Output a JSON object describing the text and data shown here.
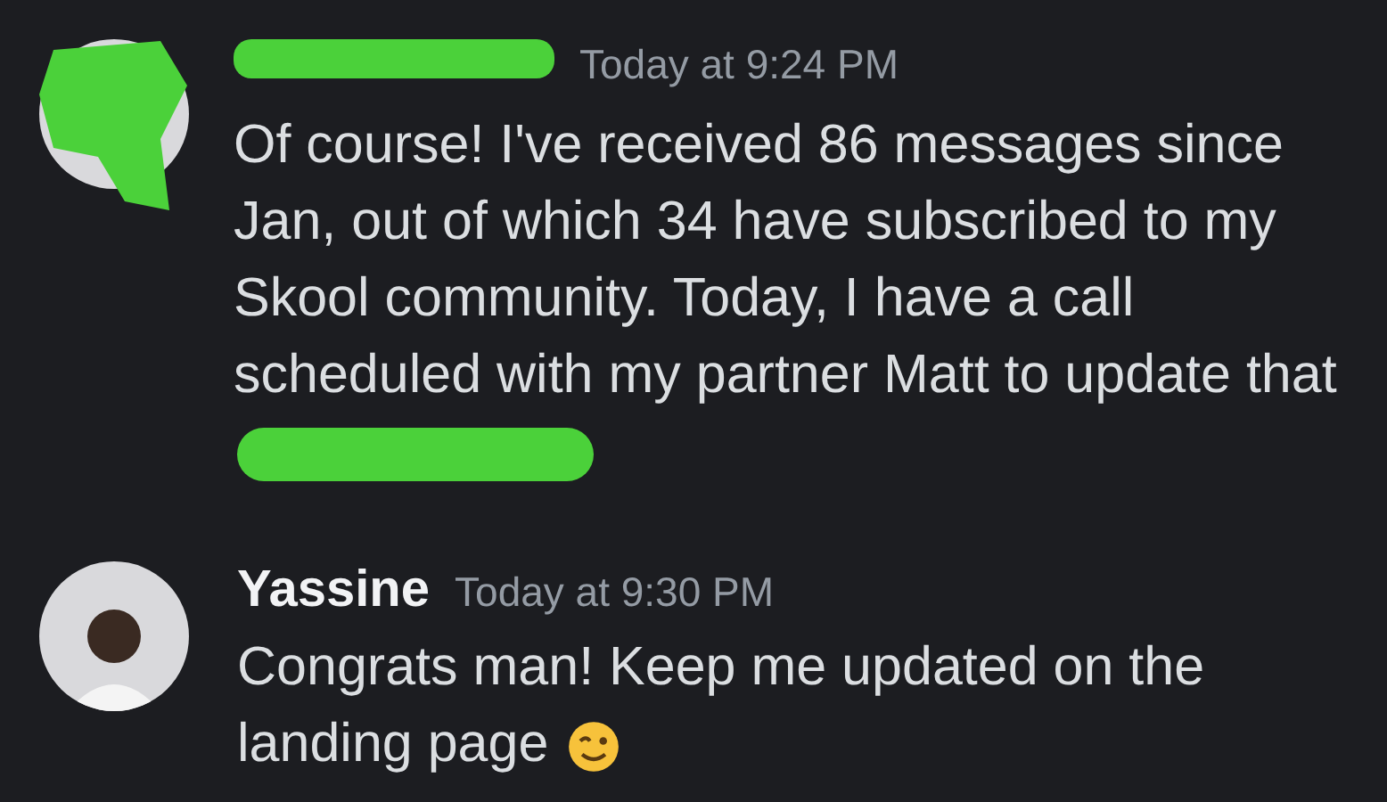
{
  "messages": [
    {
      "redacted_author": true,
      "timestamp": "Today at 9:24 PM",
      "text": "Of course! I've received 86 messages since Jan, out of which 34 have subscribed to my Skool community. Today, I have a call scheduled with my partner Matt to update that",
      "redacted_tail": true,
      "emoji": false
    },
    {
      "author": "Yassine",
      "redacted_author": false,
      "timestamp": "Today at 9:30 PM",
      "text": "Congrats man! Keep me updated on the landing page",
      "redacted_tail": false,
      "emoji": true
    }
  ]
}
